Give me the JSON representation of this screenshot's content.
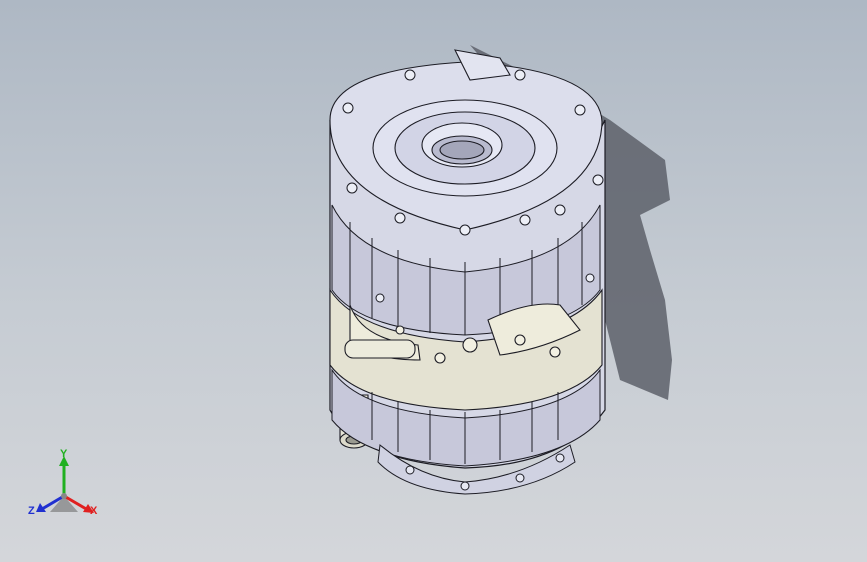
{
  "viewport": {
    "background_top": "#aeb8c4",
    "background_bottom": "#d4d6da"
  },
  "model": {
    "body_color": "#d8dae8",
    "band_color": "#c7c8da",
    "housing_color": "#e4e2d2",
    "edge_color": "#1c1c24",
    "shadow_color": "#595c66"
  },
  "triad": {
    "x_label": "X",
    "y_label": "Y",
    "z_label": "Z",
    "x_color": "#e02020",
    "y_color": "#20b020",
    "z_color": "#2030d0"
  }
}
